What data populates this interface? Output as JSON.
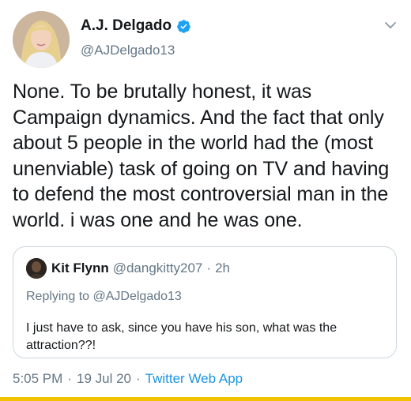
{
  "tweet": {
    "author": {
      "name": "A.J. Delgado",
      "handle": "@AJDelgado13",
      "verified": true
    },
    "text": "None. To be brutally honest, it was Campaign dynamics. And the fact that only about 5 people in the world had the (most unenviable) task of going on TV and having to defend the most controversial man in the world. i was one and he was one.",
    "quoted": {
      "author_name": "Kit Flynn",
      "author_handle": "@dangkitty207",
      "separator": "·",
      "time": "2h",
      "replying_prefix": "Replying to",
      "replying_handle": "@AJDelgado13",
      "text": "I just have to ask, since you have his son, what was the attraction??!"
    },
    "meta": {
      "time": "5:05 PM",
      "separator": "·",
      "date": "19 Jul 20",
      "app": "Twitter Web App"
    }
  },
  "colors": {
    "verified_blue": "#1da1f2",
    "link_blue": "#1b95e0",
    "secondary_text": "#657786",
    "border": "#ccd6dd",
    "bottom_bar": "#f2c100"
  },
  "icons": {
    "verified": "verified-badge-icon",
    "caret": "chevron-down-icon"
  }
}
